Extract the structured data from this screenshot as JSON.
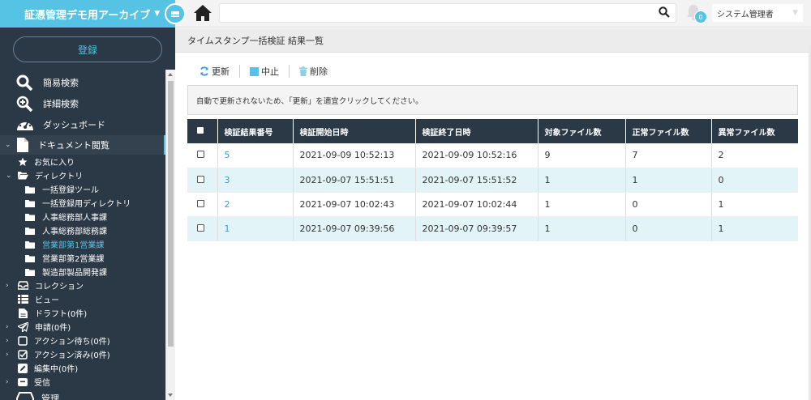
{
  "app": {
    "title": "証憑管理デモ用アーカイブ"
  },
  "header": {
    "notification_count": "0",
    "user_name": "システム管理者"
  },
  "sidebar": {
    "register_label": "登録",
    "main_items": [
      {
        "label": "簡易検索",
        "icon": "search-icon"
      },
      {
        "label": "詳細検索",
        "icon": "zoom-plus-icon"
      },
      {
        "label": "ダッシュボード",
        "icon": "dashboard-icon"
      }
    ],
    "doc_browse": "ドキュメント閲覧",
    "favorites": "お気に入り",
    "directory": "ディレクトリ",
    "folders": [
      "一括登録ツール",
      "一括登録用ディレクトリ",
      "人事総務部人事課",
      "人事総務部総務課",
      "営業部第1営業課",
      "営業部第2営業課",
      "製造部製品開発課"
    ],
    "active_folder_index": 4,
    "collection": "コレクション",
    "view": "ビュー",
    "draft": "ドラフト(0件)",
    "application": "申請(0件)",
    "pending": "アクション待ち(0件)",
    "done": "アクション済み(0件)",
    "editing": "編集中(0件)",
    "inbox": "受信",
    "admin": "管理"
  },
  "main": {
    "page_title": "タイムスタンプ一括検証 結果一覧",
    "toolbar": {
      "refresh": "更新",
      "stop": "中止",
      "delete": "削除"
    },
    "notice": "自動で更新されないため、「更新」を適宜クリックしてください。",
    "columns": [
      "検証結果番号",
      "検証開始日時",
      "検証終了日時",
      "対象ファイル数",
      "正常ファイル数",
      "異常ファイル数"
    ],
    "rows": [
      {
        "id": "5",
        "start": "2021-09-09 10:52:13",
        "end": "2021-09-09 10:52:16",
        "target": "9",
        "ok": "7",
        "ng": "2"
      },
      {
        "id": "3",
        "start": "2021-09-07 15:51:51",
        "end": "2021-09-07 15:51:52",
        "target": "1",
        "ok": "1",
        "ng": "0"
      },
      {
        "id": "2",
        "start": "2021-09-07 10:02:43",
        "end": "2021-09-07 10:02:44",
        "target": "1",
        "ok": "0",
        "ng": "1"
      },
      {
        "id": "1",
        "start": "2021-09-07 09:39:56",
        "end": "2021-09-07 09:39:57",
        "target": "1",
        "ok": "0",
        "ng": "1"
      }
    ]
  },
  "colors": {
    "accent": "#56c3e4",
    "sidebar": "#2b3845",
    "row_alt": "#e3f4f9",
    "link": "#3a9bd5"
  }
}
